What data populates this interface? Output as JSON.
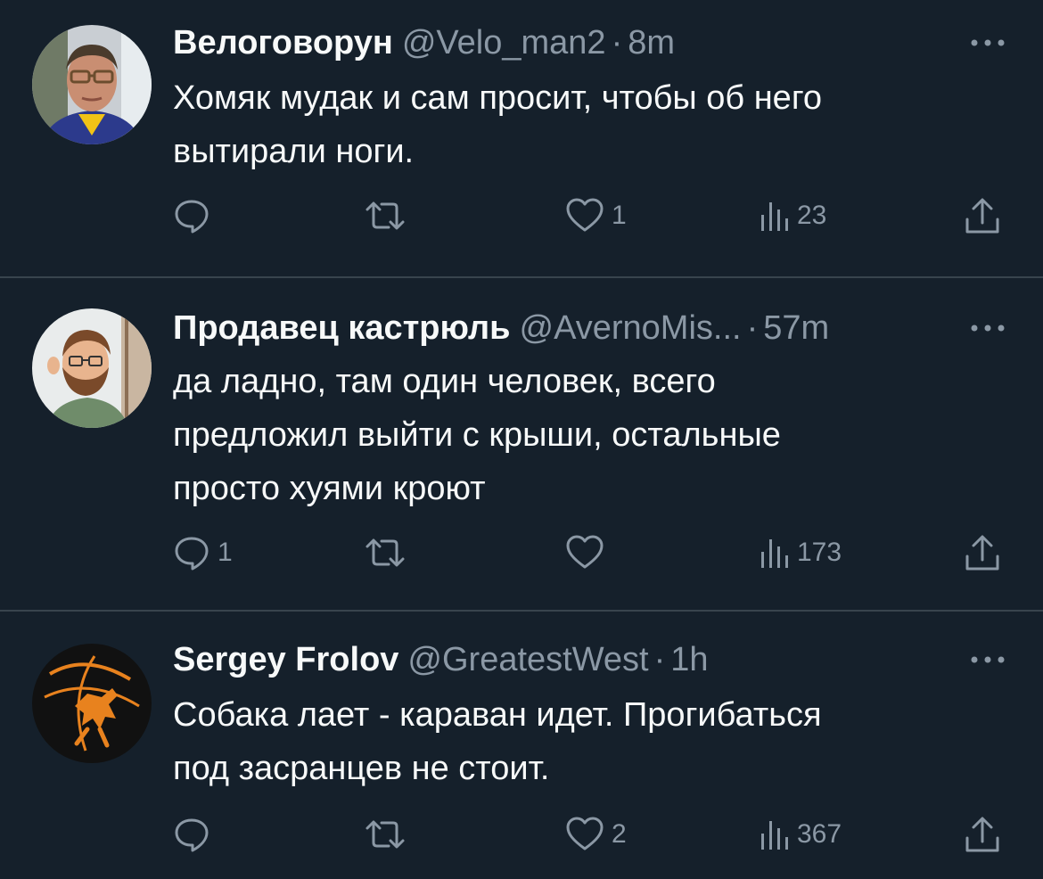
{
  "tweets": [
    {
      "name": "Велоговорун",
      "handle": "@Velo_man2",
      "separator": "·",
      "time": "8m",
      "text_lines": [
        "Хомяк мудак и сам просит, чтобы об него",
        "вытирали ноги."
      ],
      "replies": "",
      "retweets": "",
      "likes": "1",
      "views": "23"
    },
    {
      "name": "Продавец кастрюль",
      "handle": "@AvernoMis...",
      "separator": "·",
      "time": "57m",
      "text_lines": [
        "да ладно, там один человек, всего",
        "предложил выйти с крыши, остальные",
        "просто хуями кроют"
      ],
      "replies": "1",
      "retweets": "",
      "likes": "",
      "views": "173"
    },
    {
      "name": "Sergey Frolov",
      "handle": "@GreatestWest",
      "separator": "·",
      "time": "1h",
      "text_lines": [
        "Собака лает - караван идет. Прогибаться",
        "под засранцев не стоит."
      ],
      "replies": "",
      "retweets": "",
      "likes": "2",
      "views": "367"
    }
  ],
  "icons": {
    "reply": "reply-icon",
    "retweet": "retweet-icon",
    "like": "heart-icon",
    "views": "views-icon",
    "share": "share-icon",
    "more": "more-icon"
  },
  "colors": {
    "background": "#15202b",
    "text": "#f7f9f9",
    "secondary": "#8b98a5",
    "divider": "#38444d",
    "avatar3_accent": "#e8821e"
  }
}
